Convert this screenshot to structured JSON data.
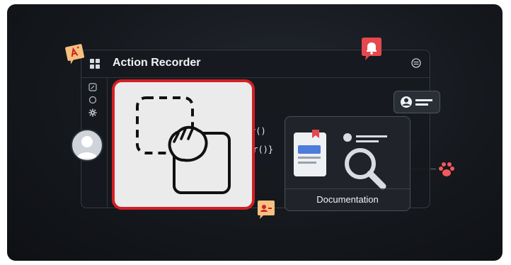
{
  "window": {
    "title": "Action Recorder"
  },
  "code_snippets": [
    "r()",
    "or()}"
  ],
  "documentation": {
    "label": "Documentation"
  },
  "icons": {
    "app_grid": "grid-icon",
    "menu": "menu-icon",
    "notification": "bell-icon",
    "translate": "translate-icon",
    "avatar": "avatar-icon",
    "drag": "drag-hand-icon",
    "search": "magnifier-icon",
    "paw": "paw-icon"
  },
  "colors": {
    "accent_red": "#d21f25",
    "alert_red": "#e5484d",
    "chip_orange": "#f4c17e",
    "paw_red": "#f1595d"
  }
}
